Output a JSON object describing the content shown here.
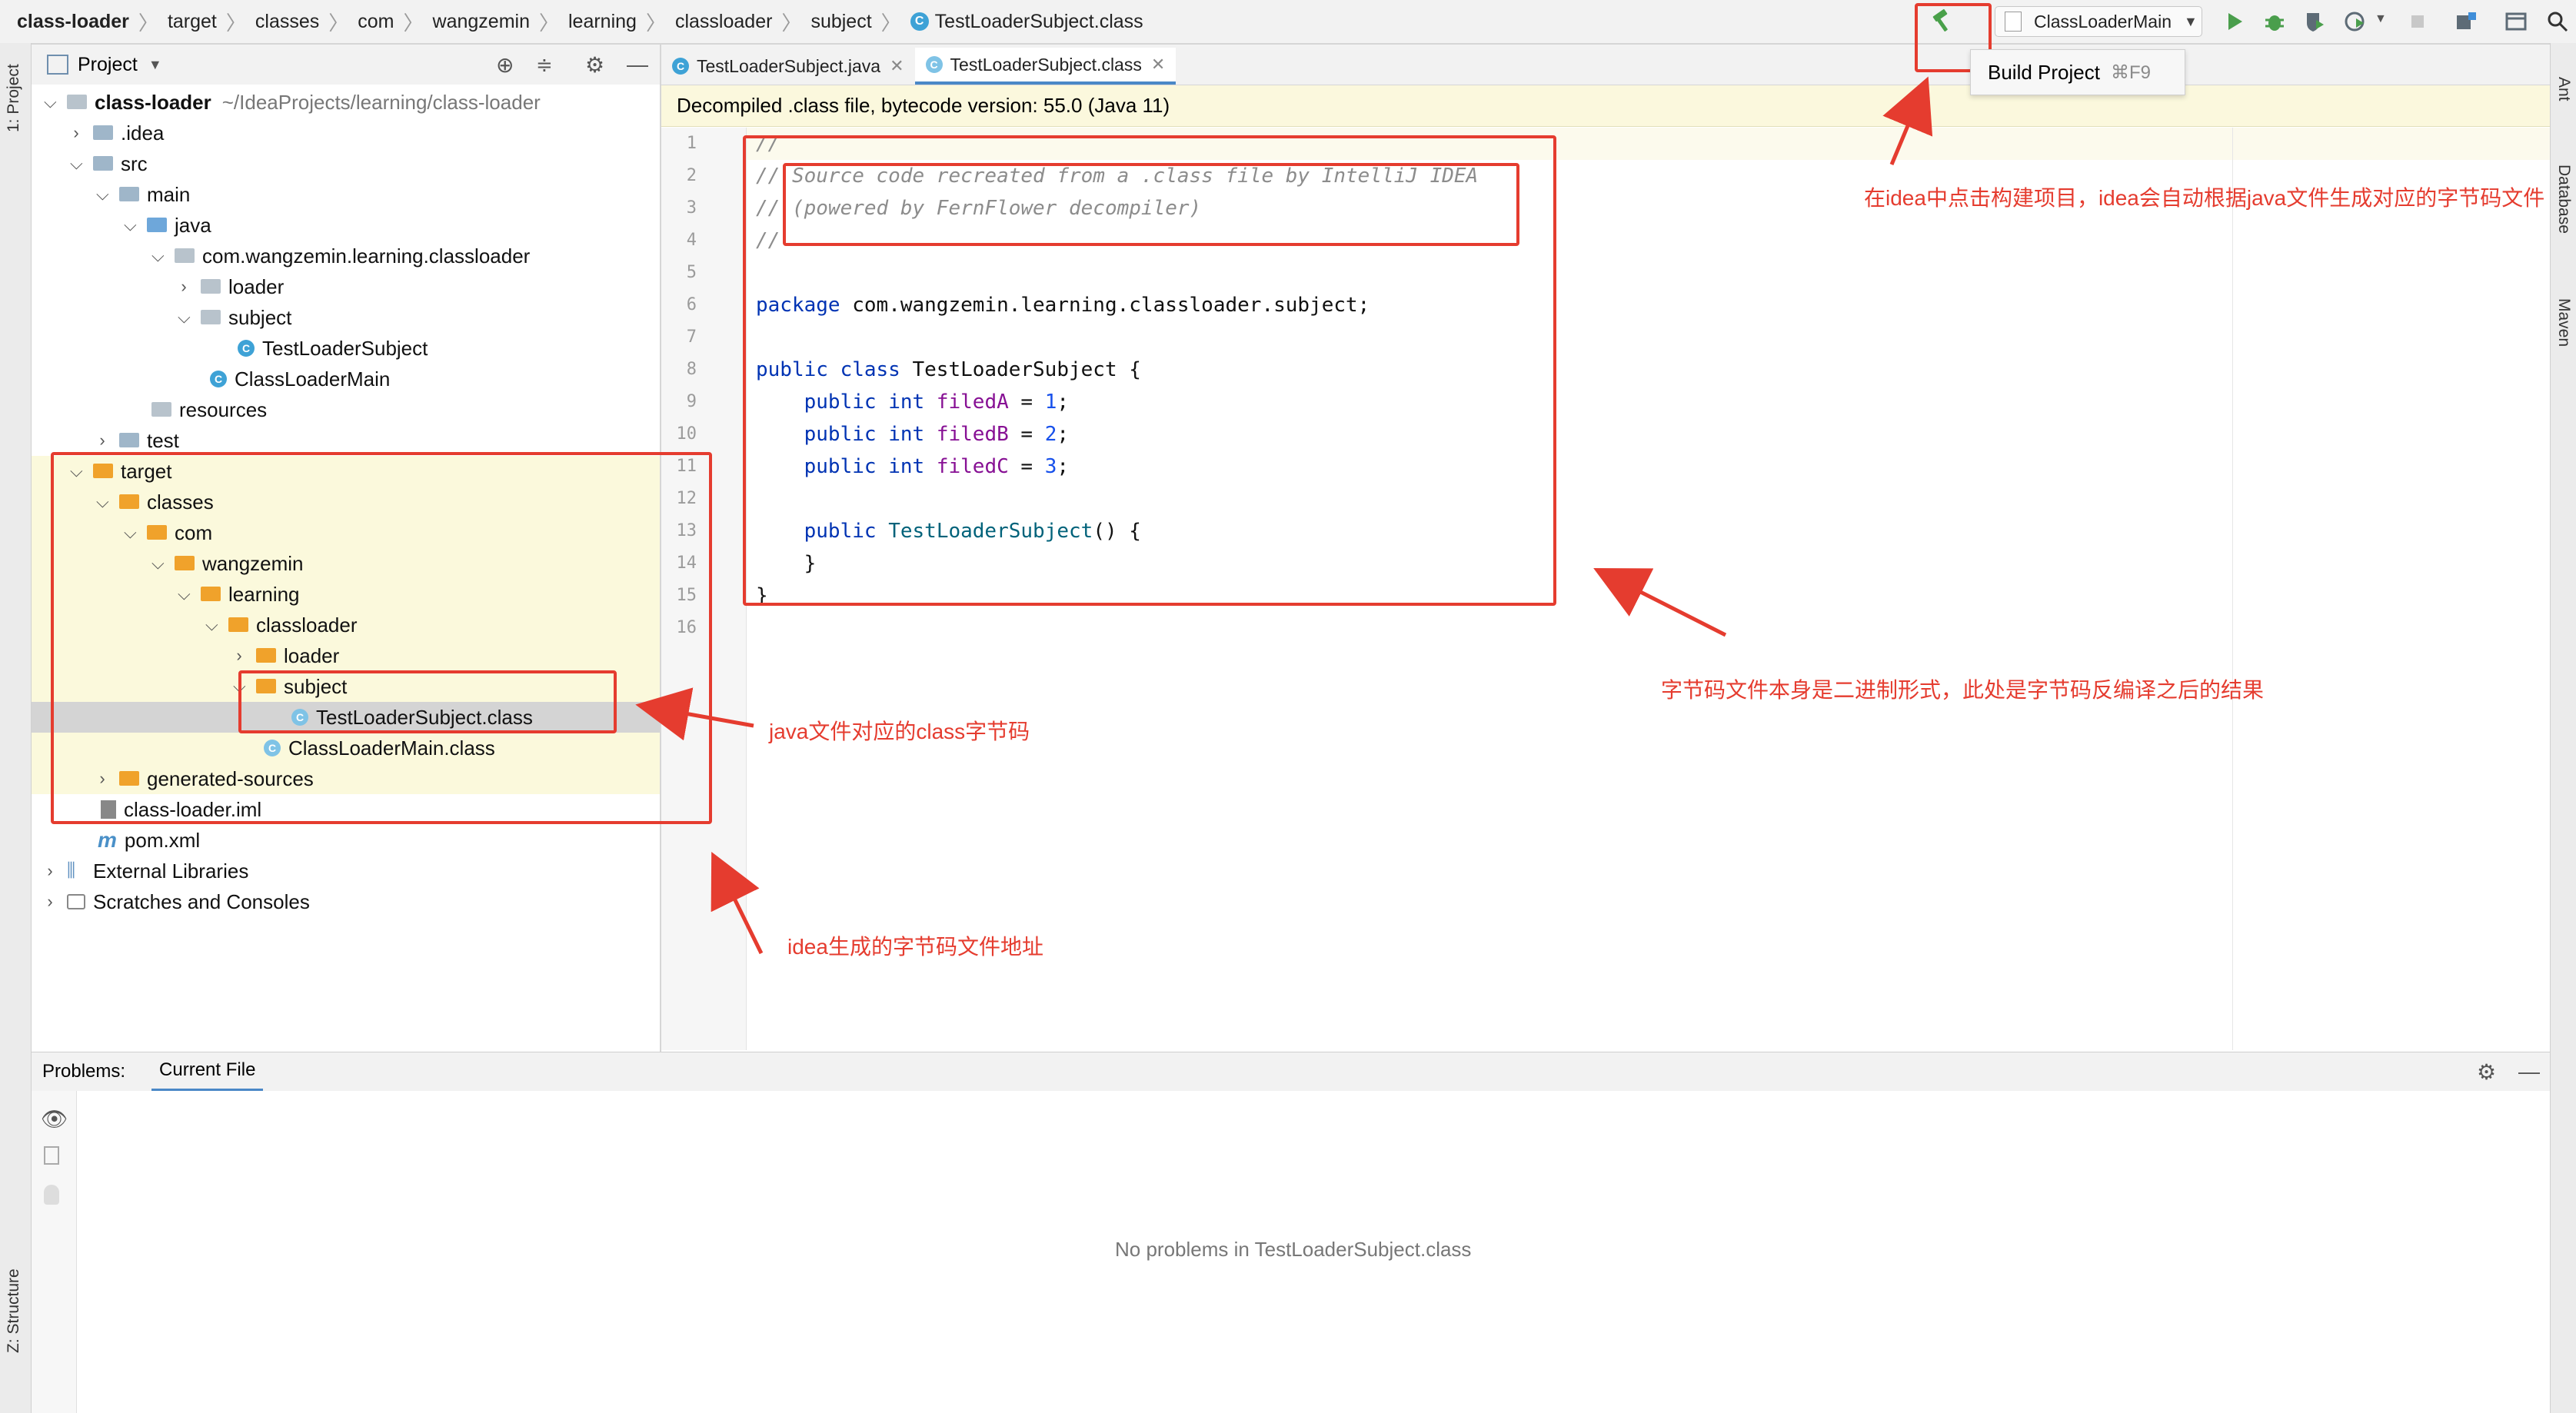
{
  "breadcrumb": {
    "items": [
      "class-loader",
      "target",
      "classes",
      "com",
      "wangzemin",
      "learning",
      "classloader",
      "subject",
      "TestLoaderSubject.class"
    ]
  },
  "toolbar": {
    "run_config": "ClassLoaderMain",
    "tooltip_label": "Build Project",
    "tooltip_shortcut": "⌘F9"
  },
  "side_tabs": {
    "project": "1: Project",
    "structure": "Z: Structure",
    "ant": "Ant",
    "database": "Database",
    "maven": "Maven"
  },
  "project_panel": {
    "title": "Project",
    "root_name": "class-loader",
    "root_path": "~/IdeaProjects/learning/class-loader",
    "tree": [
      {
        "label": ".idea"
      },
      {
        "label": "src"
      },
      {
        "label": "main"
      },
      {
        "label": "java"
      },
      {
        "label": "com.wangzemin.learning.classloader"
      },
      {
        "label": "loader"
      },
      {
        "label": "subject"
      },
      {
        "label": "TestLoaderSubject"
      },
      {
        "label": "ClassLoaderMain"
      },
      {
        "label": "resources"
      },
      {
        "label": "test"
      },
      {
        "label": "target"
      },
      {
        "label": "classes"
      },
      {
        "label": "com"
      },
      {
        "label": "wangzemin"
      },
      {
        "label": "learning"
      },
      {
        "label": "classloader"
      },
      {
        "label": "loader"
      },
      {
        "label": "subject"
      },
      {
        "label": "TestLoaderSubject.class"
      },
      {
        "label": "ClassLoaderMain.class"
      },
      {
        "label": "generated-sources"
      },
      {
        "label": "class-loader.iml"
      },
      {
        "label": "pom.xml"
      },
      {
        "label": "External Libraries"
      },
      {
        "label": "Scratches and Consoles"
      }
    ]
  },
  "editor": {
    "tabs": [
      "TestLoaderSubject.java",
      "TestLoaderSubject.class"
    ],
    "banner": "Decompiled .class file, bytecode version: 55.0 (Java 11)",
    "line_numbers": [
      "1",
      "2",
      "3",
      "4",
      "5",
      "6",
      "7",
      "8",
      "9",
      "10",
      "11",
      "12",
      "13",
      "14",
      "15",
      "16"
    ],
    "code": {
      "l1": "//",
      "l2": "// Source code recreated from a .class file by IntelliJ IDEA",
      "l3": "// (powered by FernFlower decompiler)",
      "l4": "//",
      "l6_kw": "package",
      "l6_rest": " com.wangzemin.learning.classloader.subject;",
      "l8_kw": "public class",
      "l8_rest": " TestLoaderSubject {",
      "field_kw": "public int",
      "fieldA": "filedA",
      "fieldB": "filedB",
      "fieldC": "filedC",
      "valA": "1",
      "valB": "2",
      "valC": "3",
      "ctor_kw": "public",
      "ctor_name": "TestLoaderSubject",
      "ctor_rest": "() {",
      "close_inner": "}",
      "close_outer": "}"
    }
  },
  "problems": {
    "label": "Problems:",
    "tab": "Current File",
    "empty_message": "No problems in TestLoaderSubject.class"
  },
  "annotations": {
    "build": "在idea中点击构建项目，idea会自动根据java文件生成对应的字节码文件",
    "bytecode": "字节码文件本身是二进制形式，此处是字节码反编译之后的结果",
    "class_file": "java文件对应的class字节码",
    "location": "idea生成的字节码文件地址"
  },
  "colors": {
    "annotation_red": "#e53c2f",
    "keyword": "#0033b3",
    "field": "#871094",
    "number": "#1750eb",
    "comment": "#8c8c8c"
  }
}
